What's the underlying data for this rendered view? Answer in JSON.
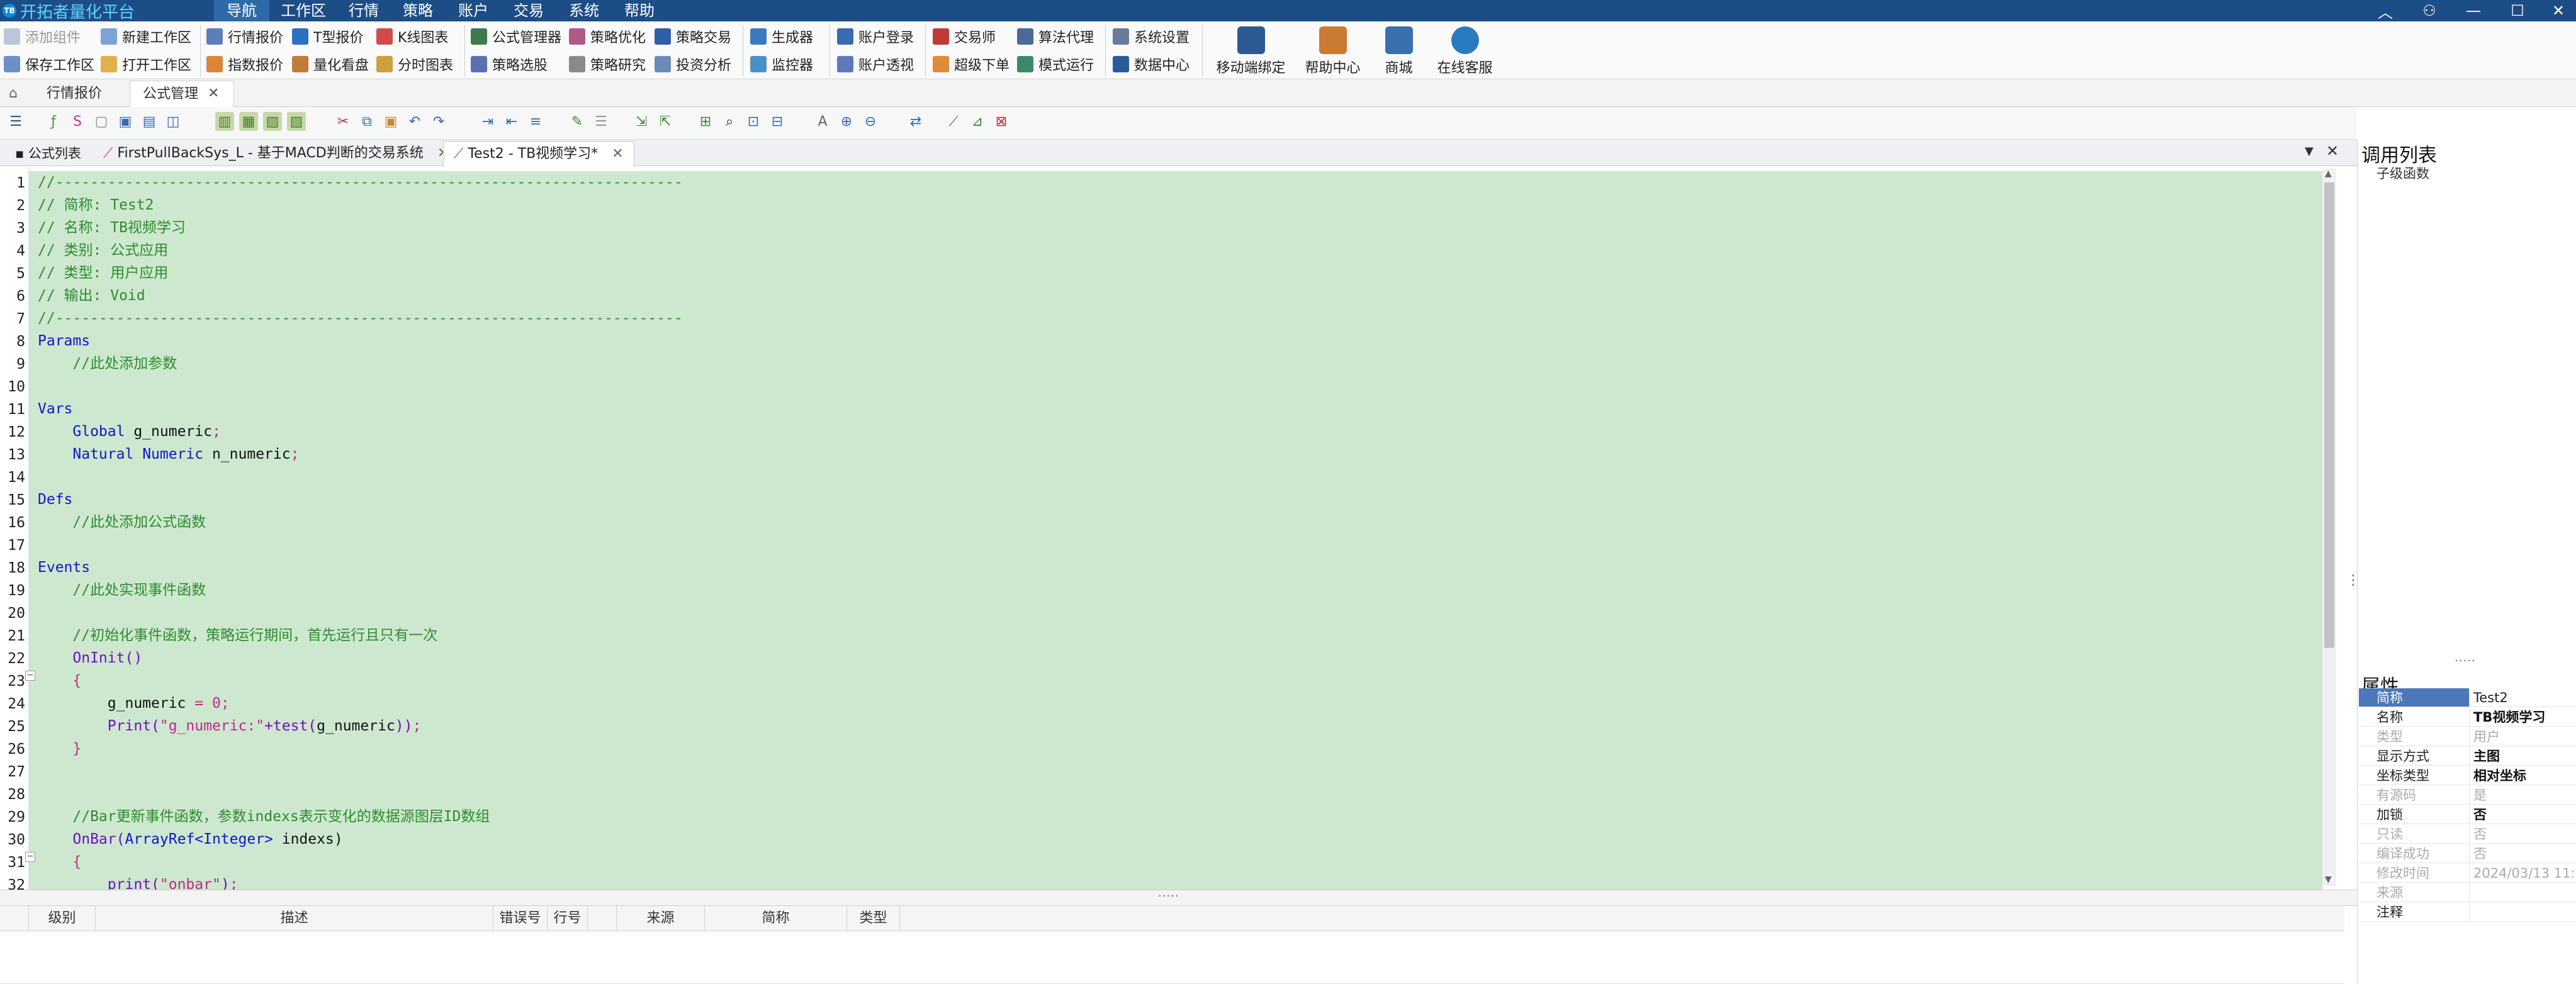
{
  "app": {
    "title": "开拓者量化平台",
    "logo": "TB"
  },
  "menu": [
    "导航",
    "工作区",
    "行情",
    "策略",
    "账户",
    "交易",
    "系统",
    "帮助"
  ],
  "ribbon": {
    "col1": [
      "添加组件",
      "保存工作区"
    ],
    "col2": [
      "新建工作区",
      "打开工作区"
    ],
    "col3": [
      "行情报价",
      "指数报价"
    ],
    "col4": [
      "T型报价",
      "量化看盘"
    ],
    "col5": [
      "K线图表",
      "分时图表"
    ],
    "col6": [
      "公式管理器",
      "策略选股"
    ],
    "col7": [
      "策略优化",
      "策略研究"
    ],
    "col8": [
      "策略交易",
      "投资分析"
    ],
    "col9": [
      "生成器",
      "监控器"
    ],
    "col10": [
      "账户登录",
      "账户透视"
    ],
    "col11": [
      "交易师",
      "超级下单"
    ],
    "col12": [
      "算法代理",
      "模式运行"
    ],
    "col13": [
      "系统设置",
      "数据中心"
    ],
    "big": [
      "移动端绑定",
      "帮助中心",
      "商城",
      "在线客服"
    ]
  },
  "page_tabs": [
    "行情报价",
    "公式管理"
  ],
  "editor_tabs": [
    "公式列表",
    "FirstPullBackSys_L - 基于MACD判断的交易系统",
    "Test2 - TB视频学习*"
  ],
  "code": [
    [
      [
        "cm",
        "//------------------------------------------------------------------------"
      ]
    ],
    [
      [
        "cm",
        "// 简称: Test2"
      ]
    ],
    [
      [
        "cm",
        "// 名称: TB视频学习"
      ]
    ],
    [
      [
        "cm",
        "// 类别: 公式应用"
      ]
    ],
    [
      [
        "cm",
        "// 类型: 用户应用"
      ]
    ],
    [
      [
        "cm",
        "// 输出: Void"
      ]
    ],
    [
      [
        "cm",
        "//------------------------------------------------------------------------"
      ]
    ],
    [
      [
        "kw",
        "Params"
      ]
    ],
    [
      [
        "pl",
        "    "
      ],
      [
        "cm",
        "//此处添加参数"
      ]
    ],
    [],
    [
      [
        "kw",
        "Vars"
      ]
    ],
    [
      [
        "pl",
        "    "
      ],
      [
        "kw",
        "Global"
      ],
      [
        "pl",
        " g_numeric"
      ],
      [
        "st",
        ";"
      ]
    ],
    [
      [
        "pl",
        "    "
      ],
      [
        "kw",
        "Natural"
      ],
      [
        "pl",
        " "
      ],
      [
        "kw",
        "Numeric"
      ],
      [
        "pl",
        " n_numeric"
      ],
      [
        "st",
        ";"
      ]
    ],
    [],
    [
      [
        "kw",
        "Defs"
      ]
    ],
    [
      [
        "pl",
        "    "
      ],
      [
        "cm",
        "//此处添加公式函数"
      ]
    ],
    [],
    [
      [
        "kw",
        "Events"
      ]
    ],
    [
      [
        "pl",
        "    "
      ],
      [
        "cm",
        "//此处实现事件函数"
      ]
    ],
    [],
    [
      [
        "pl",
        "    "
      ],
      [
        "cm",
        "//初始化事件函数，策略运行期间，首先运行且只有一次"
      ]
    ],
    [
      [
        "pl",
        "    "
      ],
      [
        "fn",
        "OnInit()"
      ]
    ],
    [
      [
        "pl",
        "    "
      ],
      [
        "st",
        "{"
      ]
    ],
    [
      [
        "pl",
        "        g_numeric "
      ],
      [
        "st",
        "="
      ],
      [
        "pl",
        " "
      ],
      [
        "st",
        "0;"
      ]
    ],
    [
      [
        "pl",
        "        "
      ],
      [
        "fn",
        "Print("
      ],
      [
        "st",
        "\"g_numeric:\""
      ],
      [
        "fn",
        "+test("
      ],
      [
        "pl",
        "g_numeric"
      ],
      [
        "fn",
        "))"
      ],
      [
        "st",
        ";"
      ]
    ],
    [
      [
        "pl",
        "    "
      ],
      [
        "st",
        "}"
      ]
    ],
    [],
    [],
    [
      [
        "pl",
        "    "
      ],
      [
        "cm",
        "//Bar更新事件函数，参数indexs表示变化的数据源图层ID数组"
      ]
    ],
    [
      [
        "pl",
        "    "
      ],
      [
        "fn",
        "OnBar("
      ],
      [
        "kw",
        "ArrayRef<Integer>"
      ],
      [
        "pl",
        " indexs)"
      ]
    ],
    [
      [
        "pl",
        "    "
      ],
      [
        "st",
        "{"
      ]
    ],
    [
      [
        "pl",
        "        "
      ],
      [
        "fn",
        "print("
      ],
      [
        "st",
        "\"onbar\""
      ],
      [
        "fn",
        ")"
      ],
      [
        "st",
        ";"
      ]
    ]
  ],
  "right_panel": {
    "call_list_title": "调用列表",
    "sub_item": "子级函数",
    "props_title": "属性",
    "props": [
      {
        "k": "简称",
        "v": "Test2",
        "style": "sel"
      },
      {
        "k": "名称",
        "v": "TB视频学习",
        "style": "b"
      },
      {
        "k": "类型",
        "v": "用户",
        "style": "dim"
      },
      {
        "k": "显示方式",
        "v": "主图",
        "style": "b"
      },
      {
        "k": "坐标类型",
        "v": "相对坐标",
        "style": "b"
      },
      {
        "k": "有源码",
        "v": "是",
        "style": "dim"
      },
      {
        "k": "加锁",
        "v": "否",
        "style": "b"
      },
      {
        "k": "只读",
        "v": "否",
        "style": "dim"
      },
      {
        "k": "编译成功",
        "v": "否",
        "style": "dim"
      },
      {
        "k": "修改时间",
        "v": "2024/03/13 11:...",
        "style": "dim"
      },
      {
        "k": "来源",
        "v": "",
        "style": "dim"
      },
      {
        "k": "注释",
        "v": "",
        "style": ""
      }
    ]
  },
  "output_columns": [
    "级别",
    "描述",
    "错误号",
    "行号",
    "来源",
    "简称",
    "类型"
  ]
}
